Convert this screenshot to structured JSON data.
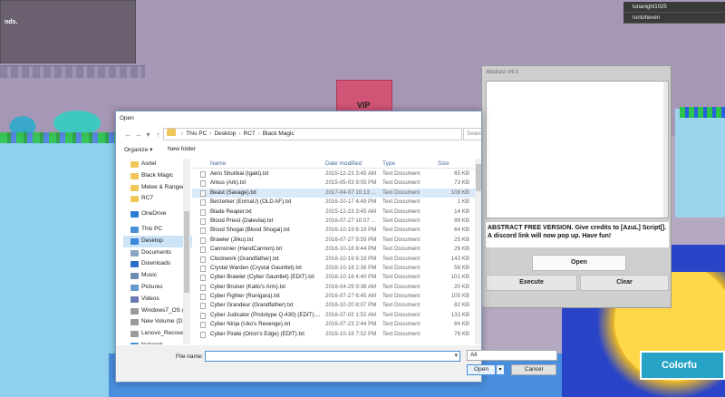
{
  "game": {
    "panel_text": "nds.",
    "vip_label": "VIP",
    "colorful_label": "Colorfu",
    "leaderboard": [
      "lunanight1025",
      "runtoheven"
    ]
  },
  "abstract_window": {
    "title": "Abstract V4.0",
    "notice": "ABSTRACT FREE VERSION. Give credits to [AzuL] Script[]. A discord link will now pop up. Have fun!",
    "open_label": "Open",
    "execute_label": "Execute",
    "clear_label": "Clear"
  },
  "open_dialog": {
    "title": "Open",
    "nav_glyphs": [
      "←",
      "→",
      "▾",
      "↑"
    ],
    "breadcrumb": [
      "This PC",
      "Desktop",
      "RC7",
      "Black Magic"
    ],
    "breadcrumb_sep": "›",
    "search_placeholder": "Searc",
    "organize_label": "Organize ▾",
    "new_folder_label": "New folder",
    "nav_items": [
      {
        "label": "Asriel",
        "icon": "folder-icon",
        "color": "#f0c85a"
      },
      {
        "label": "Black Magic",
        "icon": "folder-icon",
        "color": "#f0c85a"
      },
      {
        "label": "Melee & Ranged",
        "icon": "folder-icon",
        "color": "#f0c85a"
      },
      {
        "label": "RC7",
        "icon": "folder-icon",
        "color": "#f0c85a"
      },
      {
        "label": "OneDrive",
        "icon": "cloud-icon",
        "color": "#2a7ad8"
      },
      {
        "label": "This PC",
        "icon": "computer-icon",
        "color": "#4a90d8"
      },
      {
        "label": "Desktop",
        "icon": "desktop-icon",
        "color": "#3a86d8"
      },
      {
        "label": "Documents",
        "icon": "documents-icon",
        "color": "#8aa4c4"
      },
      {
        "label": "Downloads",
        "icon": "download-icon",
        "color": "#2a70c8"
      },
      {
        "label": "Music",
        "icon": "music-icon",
        "color": "#6a8ab0"
      },
      {
        "label": "Pictures",
        "icon": "pictures-icon",
        "color": "#6a9ac8"
      },
      {
        "label": "Videos",
        "icon": "videos-icon",
        "color": "#6a7ab0"
      },
      {
        "label": "Windows7_OS (C",
        "icon": "drive-icon",
        "color": "#9a9a9a"
      },
      {
        "label": "New Volume (D:",
        "icon": "drive-icon",
        "color": "#9a9a9a"
      },
      {
        "label": "Lenovo_Recover",
        "icon": "drive-icon",
        "color": "#9a9a9a"
      },
      {
        "label": "Network",
        "icon": "network-icon",
        "color": "#4a90d8"
      }
    ],
    "selected_nav": "Desktop",
    "columns": {
      "name": "Name",
      "date": "Date modified",
      "type": "Type",
      "size": "Size"
    },
    "sort_glyph": "^",
    "files": [
      {
        "name": "Aero Shurikai (Igaki).txt",
        "date": "2015-12-23 3:45 AM",
        "type": "Text Document",
        "size": "65 KB"
      },
      {
        "name": "Arkus (Ark).txt",
        "date": "2015-05-03 9:05 PM",
        "type": "Text Document",
        "size": "73 KB"
      },
      {
        "name": "Beast (Savage).txt",
        "date": "2017-04-07 10:13 ...",
        "type": "Text Document",
        "size": "108 KB"
      },
      {
        "name": "Berzerker (EnmaU) (OLD AF).txt",
        "date": "2016-10-17 4:49 PM",
        "type": "Text Document",
        "size": "1 KB"
      },
      {
        "name": "Blade Reaper.txt",
        "date": "2015-12-23 3:45 AM",
        "type": "Text Document",
        "size": "14 KB"
      },
      {
        "name": "Blood Priest (Dalevila).txt",
        "date": "2016-07-27 10:07 ...",
        "type": "Text Document",
        "size": "99 KB"
      },
      {
        "name": "Blood Shogai (Blood Shogai).txt",
        "date": "2016-10-19 6:19 PM",
        "type": "Text Document",
        "size": "64 KB"
      },
      {
        "name": "Brawler (Jiiku).txt",
        "date": "2016-07-27 9:59 PM",
        "type": "Text Document",
        "size": "25 KB"
      },
      {
        "name": "Cannonier (HandCannon).txt",
        "date": "2016-10-18 8:44 PM",
        "type": "Text Document",
        "size": "26 KB"
      },
      {
        "name": "Clockwork (Grandfather).txt",
        "date": "2016-10-19 6:19 PM",
        "type": "Text Document",
        "size": "143 KB"
      },
      {
        "name": "Crystal Warden (Crystal Gauntlet).txt",
        "date": "2016-10-18 2:38 PM",
        "type": "Text Document",
        "size": "58 KB"
      },
      {
        "name": "Cyber Brawler (Cyber Gauntlet) (EDIT).txt",
        "date": "2016-10-18 4:40 PM",
        "type": "Text Document",
        "size": "101 KB"
      },
      {
        "name": "Cyber Bruiser (Kalto's Arm).txt",
        "date": "2016-04-29 9:38 AM",
        "type": "Text Document",
        "size": "20 KB"
      },
      {
        "name": "Cyber Fighter (Runigara).txt",
        "date": "2016-07-27 6:45 AM",
        "type": "Text Document",
        "size": "105 KB"
      },
      {
        "name": "Cyber Grandeur (Grandfather).txt",
        "date": "2016-10-20 8:07 PM",
        "type": "Text Document",
        "size": "82 KB"
      },
      {
        "name": "Cyber Judicator (Prototype Q-430) (EDIT)....",
        "date": "2016-07-02 1:52 AM",
        "type": "Text Document",
        "size": "133 KB"
      },
      {
        "name": "Cyber Ninja (Uko's Revenge).txt",
        "date": "2016-07-23 2:44 PM",
        "type": "Text Document",
        "size": "84 KB"
      },
      {
        "name": "Cyber Pirate (Orion's Edge) (EDIT).txt",
        "date": "2016-10-18 7:52 PM",
        "type": "Text Document",
        "size": "76 KB"
      }
    ],
    "selected_file": "Beast (Savage).txt",
    "filename_label": "File name:",
    "filename_value": "",
    "filetype_value": "All",
    "open_button": "Open",
    "open_dropdown": "▾",
    "cancel_button": "Cancel"
  }
}
